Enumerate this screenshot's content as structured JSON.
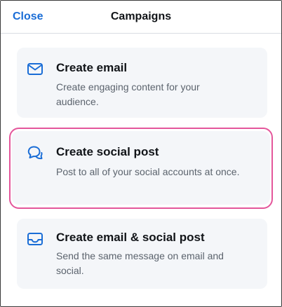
{
  "header": {
    "close_label": "Close",
    "title": "Campaigns"
  },
  "options": [
    {
      "icon": "mail-icon",
      "title": "Create email",
      "description": "Create engaging content for your audience."
    },
    {
      "icon": "chat-bubbles-icon",
      "title": "Create social post",
      "description": "Post to all of your social accounts at once."
    },
    {
      "icon": "inbox-tray-icon",
      "title": "Create email & social post",
      "description": "Send the same message on email and social."
    }
  ],
  "colors": {
    "accent": "#1a6dd6",
    "highlight": "#e4569b",
    "card_bg": "#f4f6f9"
  }
}
